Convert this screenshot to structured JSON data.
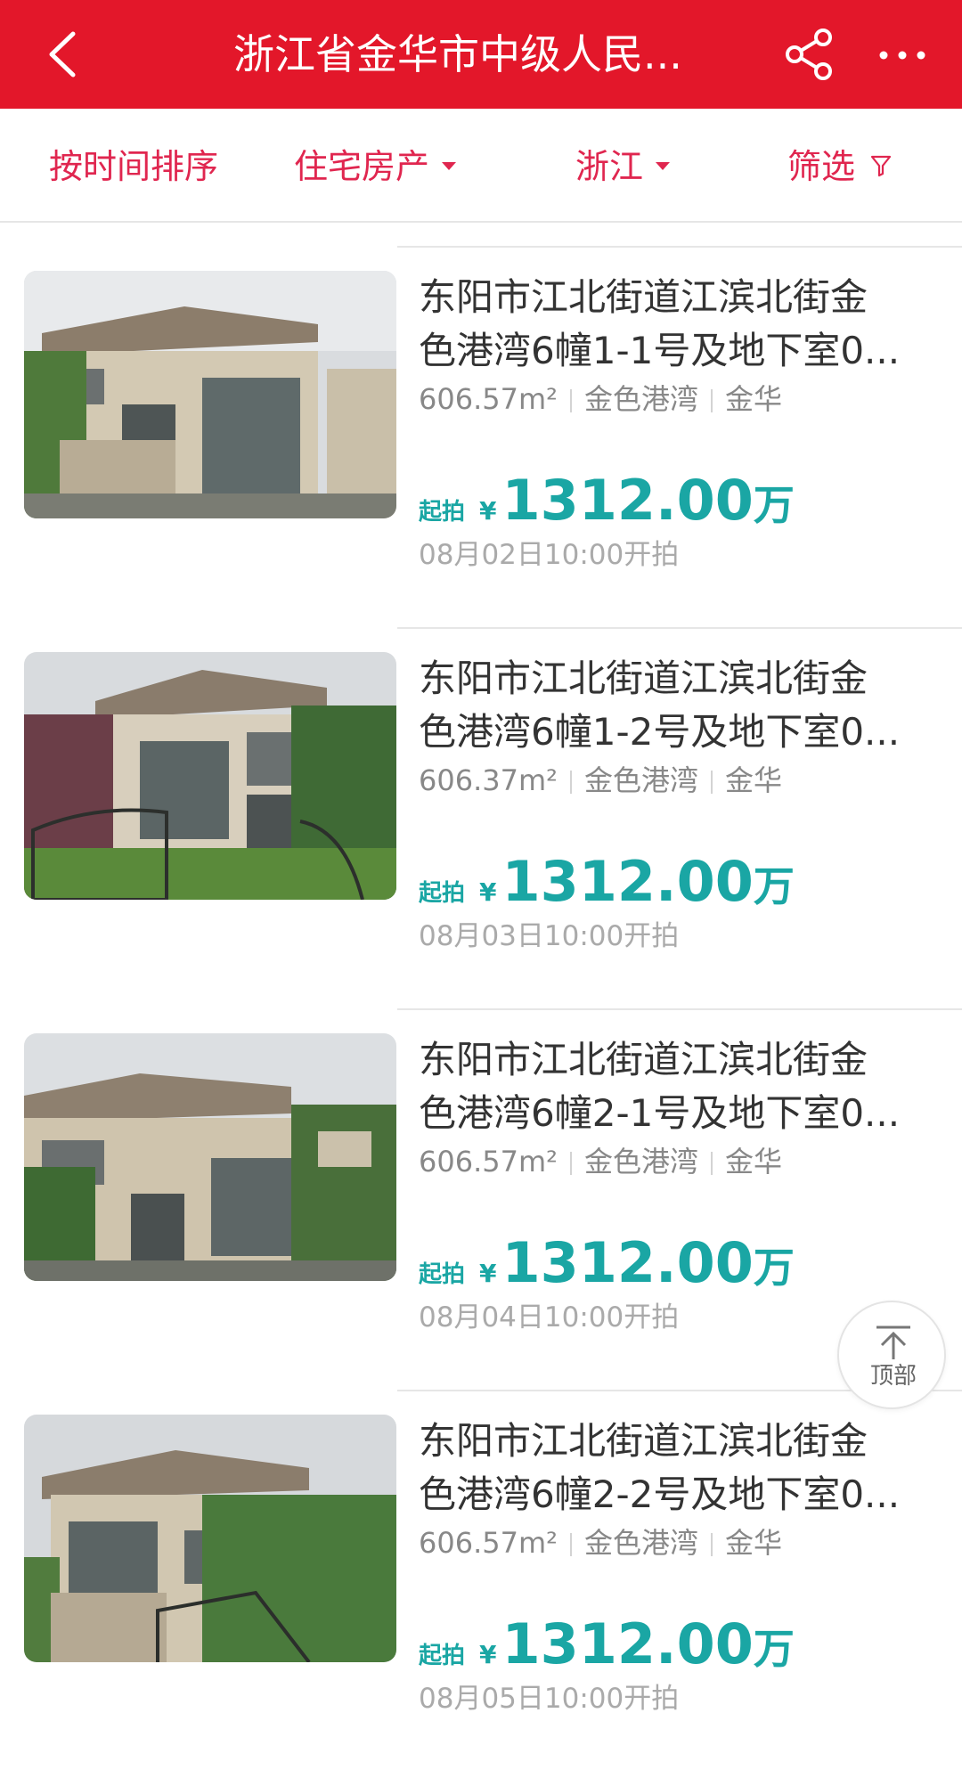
{
  "header": {
    "title": "浙江省金华市中级人民...",
    "back_icon": "chevron-left-icon",
    "share_icon": "share-icon",
    "more_icon": "more-dots-icon",
    "color": "#e3172a"
  },
  "filters": {
    "sort": "按时间排序",
    "type": "住宅房产",
    "region": "浙江",
    "filter": "筛选"
  },
  "listings": [
    {
      "title_line1": "东阳市江北街道江滨北街金",
      "title_line2": "色港湾6幢1-1号及地下室0...",
      "area": "606.57m²",
      "community": "金色港湾",
      "city": "金华",
      "start_label": "起拍",
      "currency": "¥",
      "price": "1312.00",
      "unit": "万",
      "time": "08月02日10:00开拍"
    },
    {
      "title_line1": "东阳市江北街道江滨北街金",
      "title_line2": "色港湾6幢1-2号及地下室0...",
      "area": "606.37m²",
      "community": "金色港湾",
      "city": "金华",
      "start_label": "起拍",
      "currency": "¥",
      "price": "1312.00",
      "unit": "万",
      "time": "08月03日10:00开拍"
    },
    {
      "title_line1": "东阳市江北街道江滨北街金",
      "title_line2": "色港湾6幢2-1号及地下室0...",
      "area": "606.57m²",
      "community": "金色港湾",
      "city": "金华",
      "start_label": "起拍",
      "currency": "¥",
      "price": "1312.00",
      "unit": "万",
      "time": "08月04日10:00开拍"
    },
    {
      "title_line1": "东阳市江北街道江滨北街金",
      "title_line2": "色港湾6幢2-2号及地下室0...",
      "area": "606.57m²",
      "community": "金色港湾",
      "city": "金华",
      "start_label": "起拍",
      "currency": "¥",
      "price": "1312.00",
      "unit": "万",
      "time": "08月05日10:00开拍"
    }
  ],
  "to_top": {
    "label": "顶部",
    "icon": "arrow-up-icon"
  },
  "colors": {
    "accent": "#e0264f",
    "price": "#1aa6a4",
    "header": "#e3172a"
  }
}
